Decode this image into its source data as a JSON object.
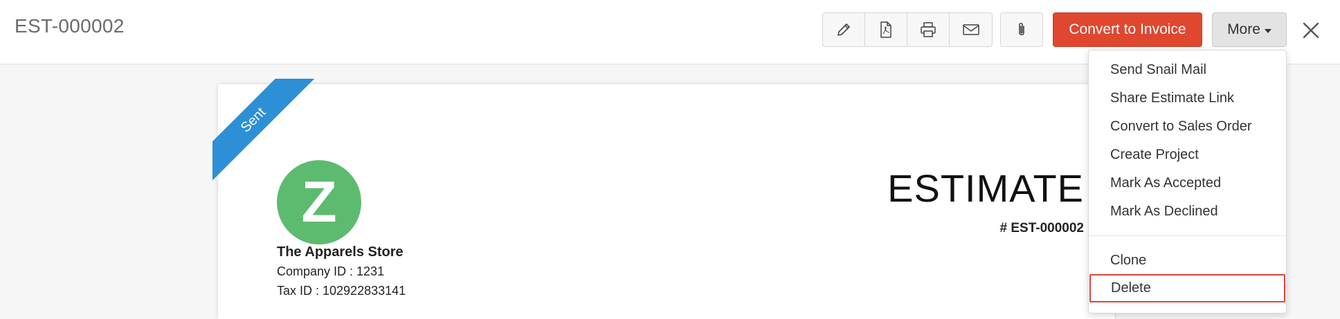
{
  "header": {
    "title": "EST-000002",
    "convert_label": "Convert to Invoice",
    "more_label": "More"
  },
  "toolbar_icons": [
    "pencil-icon",
    "pdf-icon",
    "printer-icon",
    "mail-icon",
    "paperclip-icon",
    "close-icon"
  ],
  "colors": {
    "convert": "#e0472f",
    "ribbon": "#2d8fd5",
    "logo": "#5dbb6f",
    "highlight": "#e2403a"
  },
  "document": {
    "status_ribbon": "Sent",
    "logo_letter": "Z",
    "company_name": "The Apparels Store",
    "company_id": "Company ID : 1231",
    "tax_id": "Tax ID : 102922833141",
    "heading": "ESTIMATE",
    "number": "# EST-000002"
  },
  "more_menu": {
    "items": [
      "Send Snail Mail",
      "Share Estimate Link",
      "Convert to Sales Order",
      "Create Project",
      "Mark As Accepted",
      "Mark As Declined",
      "Clone",
      "Delete"
    ]
  }
}
